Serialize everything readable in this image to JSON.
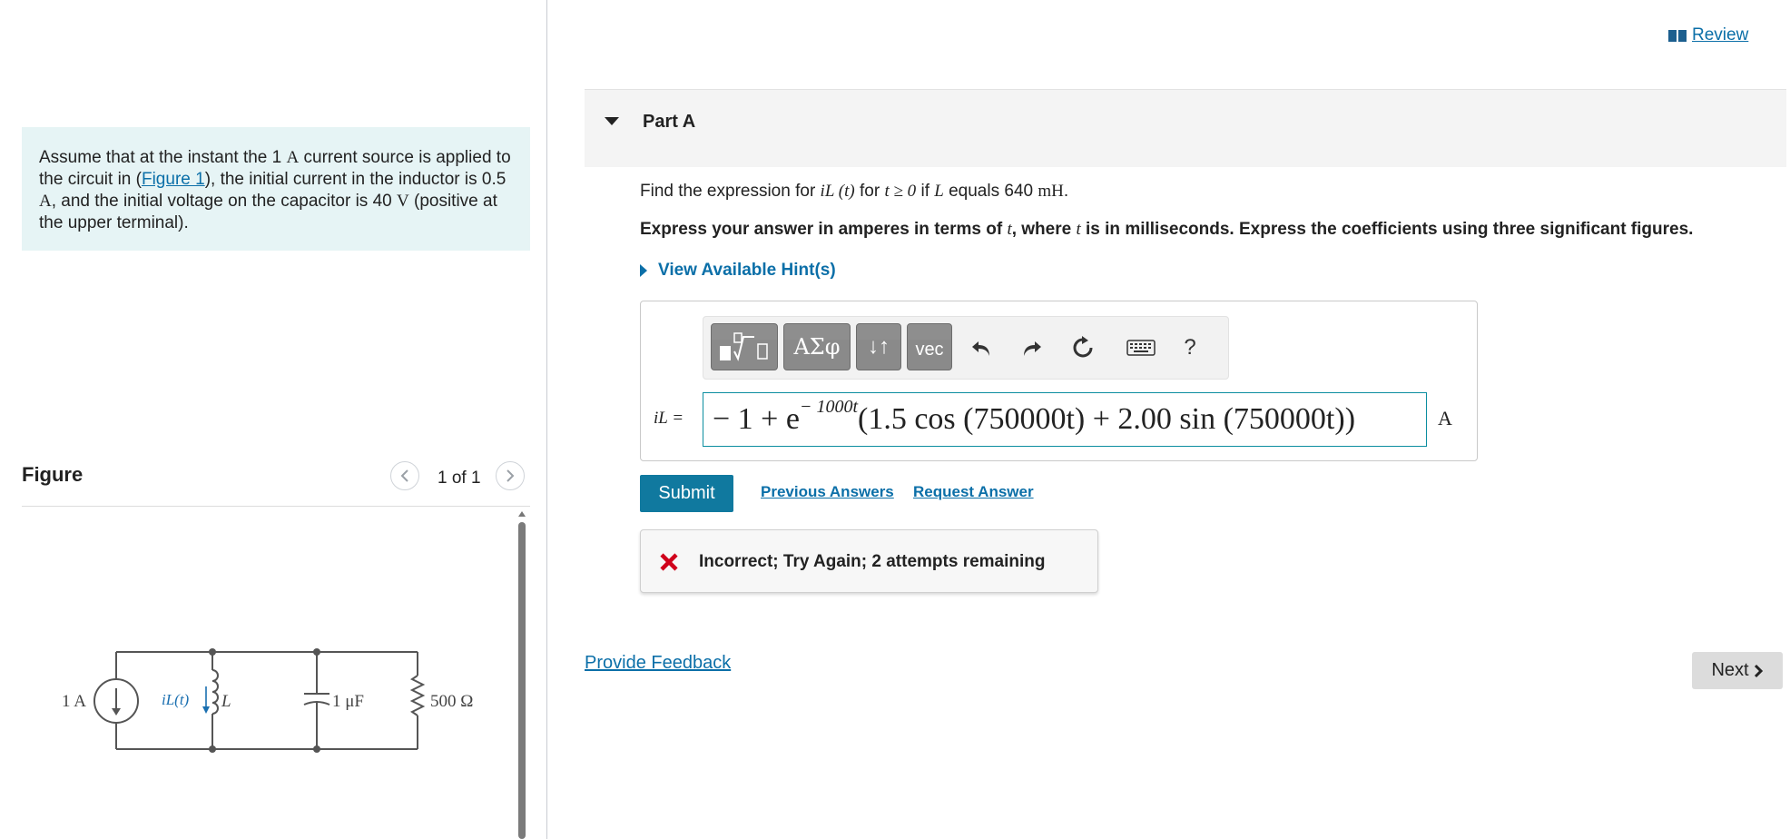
{
  "header": {
    "review_label": "Review"
  },
  "problem": {
    "text_1": "Assume that at the instant the 1 ",
    "unit_A": "A",
    "text_2": " current source is applied to the circuit in (",
    "figure_link": "Figure 1",
    "text_3": "), the initial current in the inductor is 0.5 ",
    "unit_A2": "A",
    "text_4": ", and the initial voltage on the capacitor is 40 ",
    "unit_V": "V",
    "text_5": " (positive at the upper terminal)."
  },
  "figure": {
    "title": "Figure",
    "counter": "1 of 1",
    "labels": {
      "source": "1 A",
      "current": "iL(t)",
      "inductor": "L",
      "capacitor": "1 μF",
      "resistor": "500 Ω"
    }
  },
  "part": {
    "title": "Part A",
    "question_prefix": "Find the expression for ",
    "question_var": "iL (t)",
    "question_mid": " for ",
    "question_cond": "t ≥ 0",
    "question_if": " if ",
    "question_L": "L",
    "question_equals": " equals 640 ",
    "question_unit": "mH",
    "question_end": ".",
    "instructions_1": "Express your answer in amperes in terms of ",
    "instructions_t1": "t",
    "instructions_2": ", where ",
    "instructions_t2": "t",
    "instructions_3": " is in milliseconds. Express the coefficients using three significant figures.",
    "hints_label": "View Available Hint(s)"
  },
  "answer": {
    "variable_label": "iL =",
    "expr_main_1": "− 1 + e",
    "expr_sup": "− 1000t",
    "expr_main_2": "(1.5 cos (750000t) + 2.00 sin (750000t))",
    "unit": "A",
    "toolbar": {
      "templates": "√",
      "symbols": "ΑΣφ",
      "subsup": "↓↑",
      "vec": "vec",
      "help": "?"
    }
  },
  "actions": {
    "submit_label": "Submit",
    "previous_answers": "Previous Answers",
    "request_answer": "Request Answer"
  },
  "feedback": {
    "message": "Incorrect; Try Again; 2 attempts remaining"
  },
  "footer": {
    "provide_feedback": "Provide Feedback",
    "next_label": "Next"
  },
  "colors": {
    "accent": "#0b6fa8",
    "submit_bg": "#10799f",
    "problem_bg": "#e6f4f5",
    "error": "#d0021b"
  }
}
